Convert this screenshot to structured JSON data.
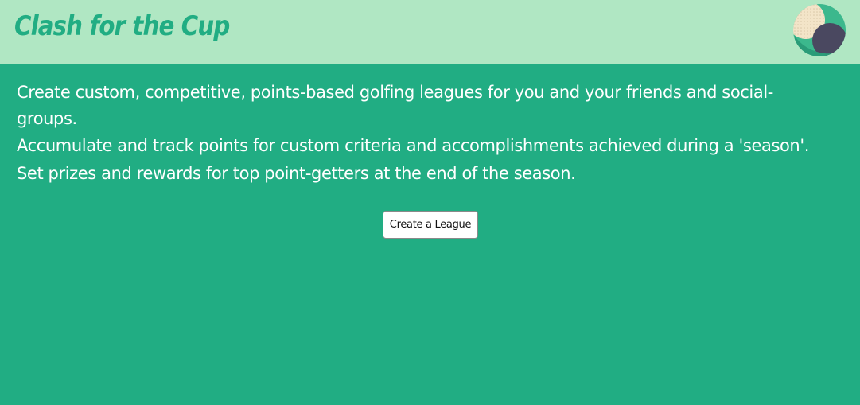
{
  "header": {
    "brand_title": "Clash for the Cup",
    "avatar_icon": "golf-ball-profile-avatar"
  },
  "main": {
    "paragraphs": [
      "Create custom, competitive, points-based golfing leagues for you and your friends and social-groups.",
      "Accumulate and track points for custom criteria and accomplishments achieved during a 'season'.",
      "Set prizes and rewards for top point-getters at the end of the season."
    ],
    "create_button_label": "Create a League"
  },
  "colors": {
    "background": "#21ad83",
    "header_background": "#b0e7c3",
    "brand_text": "#21ad83",
    "body_text": "#ffffff"
  }
}
